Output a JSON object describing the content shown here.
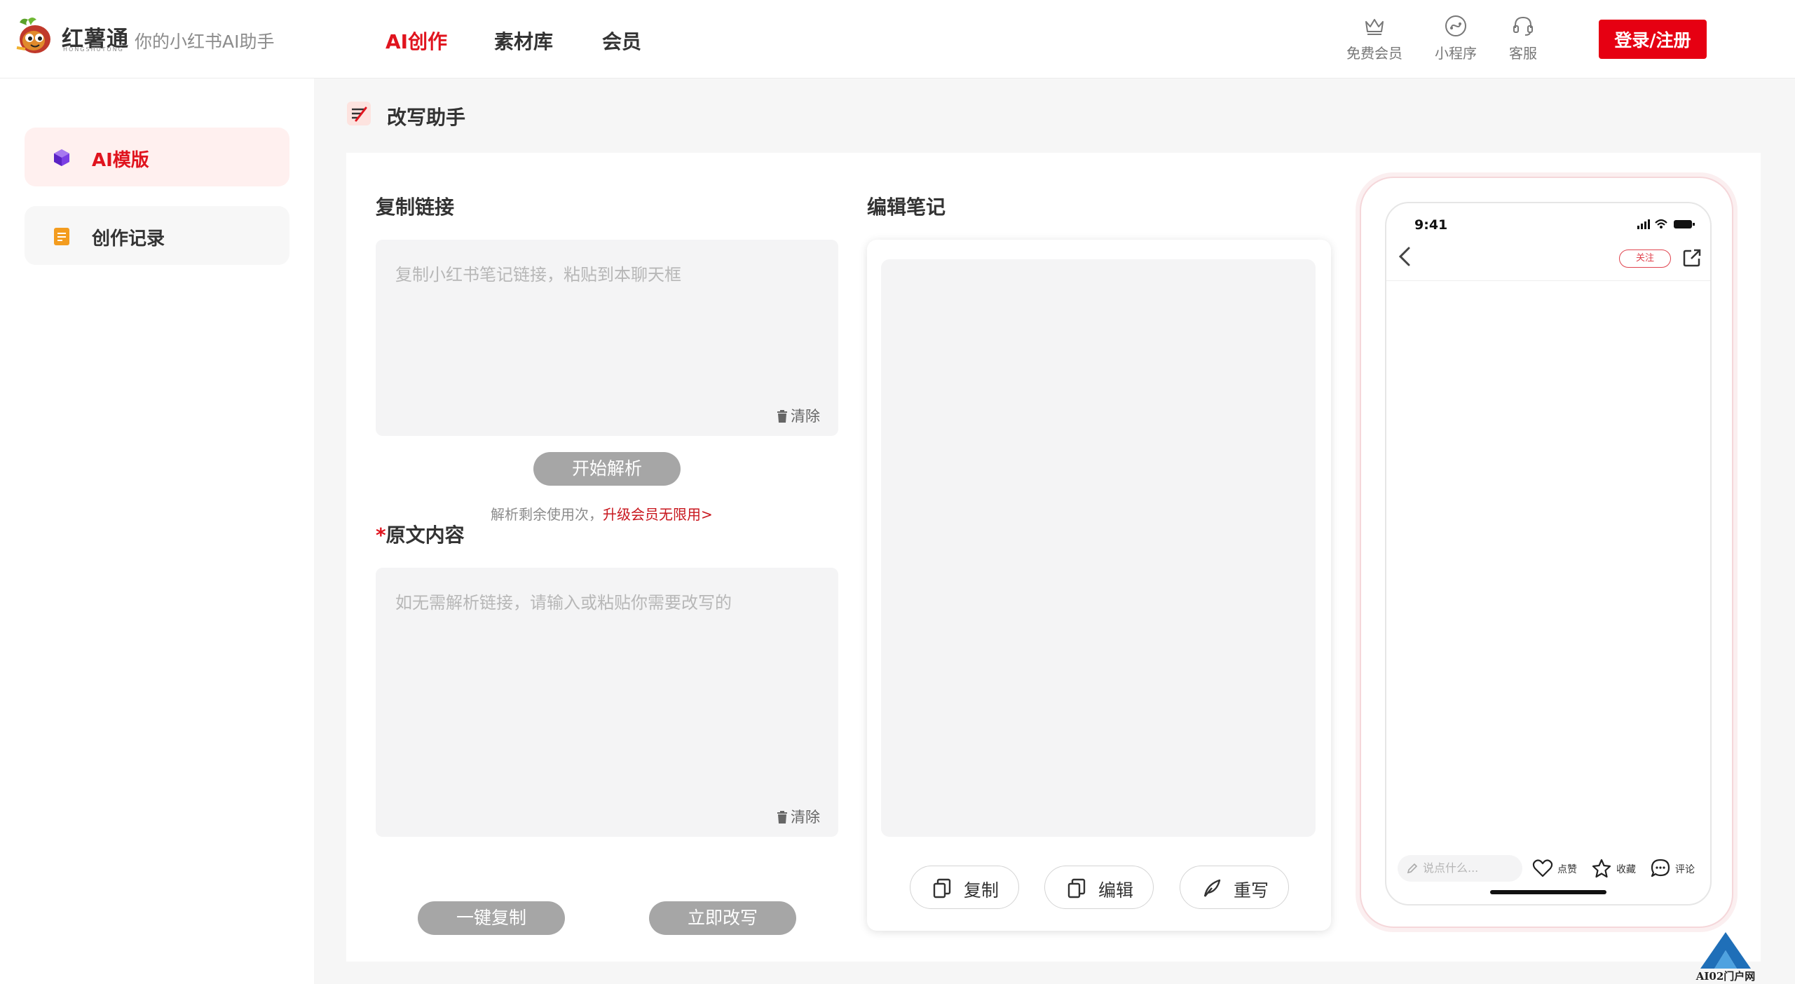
{
  "header": {
    "logo_name": "红薯通",
    "logo_sub": "HONGSHUTONG",
    "slogan": "你的小红书AI助手",
    "nav": [
      {
        "label": "AI创作",
        "active": true
      },
      {
        "label": "素材库",
        "active": false
      },
      {
        "label": "会员",
        "active": false
      }
    ],
    "tools": [
      {
        "icon": "crown-icon",
        "label": "免费会员"
      },
      {
        "icon": "mini-program-icon",
        "label": "小程序"
      },
      {
        "icon": "headset-icon",
        "label": "客服"
      }
    ],
    "login_label": "登录/注册",
    "accent_color": "#e60012"
  },
  "sidebar": {
    "items": [
      {
        "icon": "cube-icon",
        "label": "AI模版",
        "active": true
      },
      {
        "icon": "notepad-icon",
        "label": "创作记录",
        "active": false
      }
    ]
  },
  "main": {
    "page_title": "改写助手",
    "link_section": {
      "label": "复制链接",
      "placeholder": "复制小红书笔记链接，粘贴到本聊天框",
      "clear_label": "清除",
      "parse_button": "开始解析",
      "hint_prefix": "解析剩余使用次，",
      "hint_upgrade": "升级会员无限用>"
    },
    "original_section": {
      "required_mark": "*",
      "label": "原文内容",
      "placeholder": "如无需解析链接，请输入或粘贴你需要改写的",
      "clear_label": "清除",
      "copy_all_button": "一键复制",
      "rewrite_now_button": "立即改写"
    },
    "editor_section": {
      "label": "编辑笔记",
      "actions": [
        {
          "icon": "copy-icon",
          "label": "复制"
        },
        {
          "icon": "copy-icon",
          "label": "编辑"
        },
        {
          "icon": "feather-icon",
          "label": "重写"
        }
      ]
    },
    "phone_preview": {
      "status_time": "9:41",
      "follow_label": "关注",
      "comment_placeholder": "说点什么...",
      "like_label": "点赞",
      "collect_label": "收藏",
      "comment_label": "评论"
    }
  },
  "watermark": {
    "text": "AI02门户网"
  }
}
